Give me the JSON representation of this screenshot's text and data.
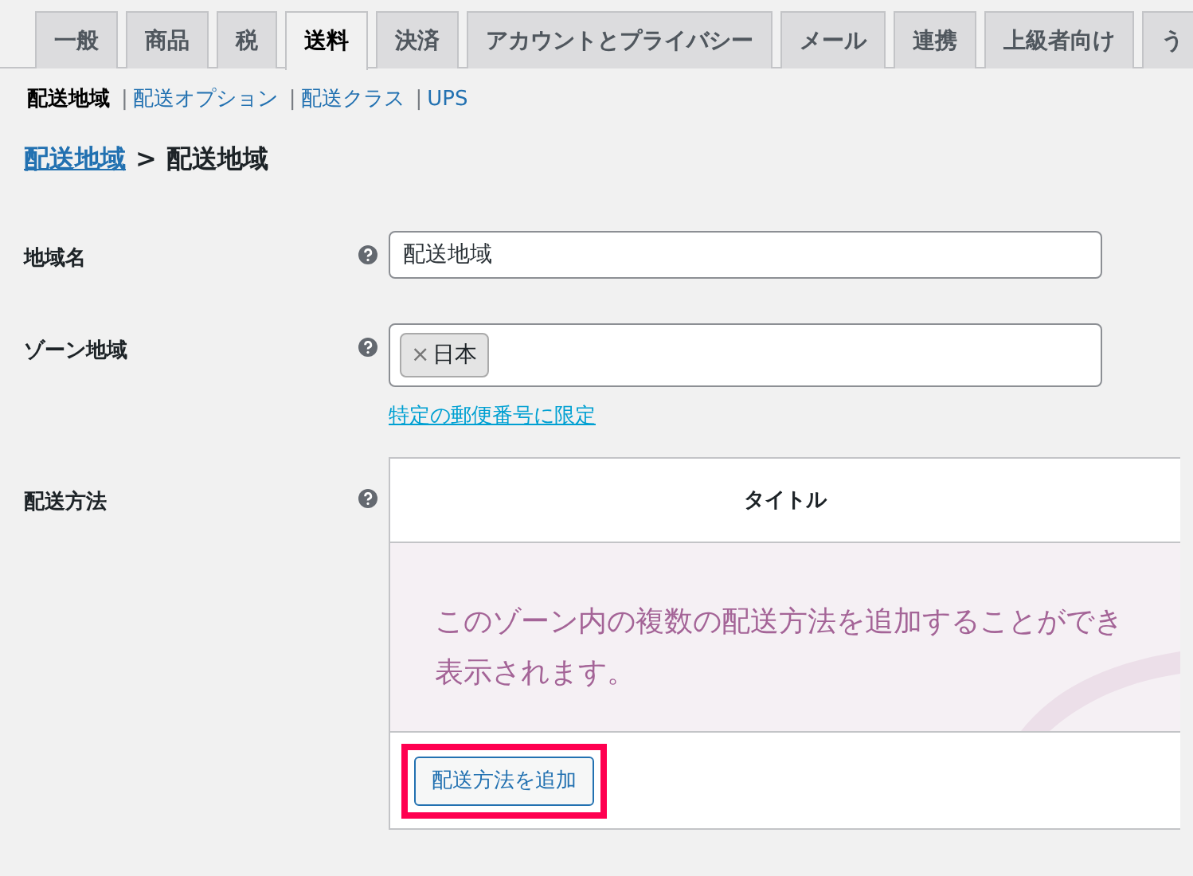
{
  "tabs": [
    {
      "label": "一般",
      "selected": false
    },
    {
      "label": "商品",
      "selected": false
    },
    {
      "label": "税",
      "selected": false
    },
    {
      "label": "送料",
      "selected": true
    },
    {
      "label": "決済",
      "selected": false
    },
    {
      "label": "アカウントとプライバシー",
      "selected": false
    },
    {
      "label": "メール",
      "selected": false
    },
    {
      "label": "連携",
      "selected": false
    },
    {
      "label": "上級者向け",
      "selected": false
    },
    {
      "label": "う",
      "selected": false
    }
  ],
  "subnav": [
    {
      "label": "配送地域",
      "selected": true
    },
    {
      "divider": "|",
      "label": "配送オプション",
      "selected": false
    },
    {
      "divider": "|",
      "label": "配送クラス",
      "selected": false
    },
    {
      "divider": "|",
      "label": "UPS",
      "selected": false
    }
  ],
  "breadcrumb": {
    "link": "配送地域",
    "separator": ">",
    "current": "配送地域"
  },
  "form": {
    "zone_name": {
      "label": "地域名",
      "value": "配送地域"
    },
    "zone_regions": {
      "label": "ゾーン地域",
      "tags": [
        {
          "remove": "×",
          "label": "日本"
        }
      ],
      "link": "特定の郵便番号に限定"
    },
    "shipping_methods": {
      "label": "配送方法",
      "column": "タイトル",
      "empty_lines": [
        "このゾーン内の複数の配送方法を追加することができ",
        "表示されます。"
      ],
      "button": {
        "label": "配送方法を追加",
        "highlighted": true
      }
    }
  }
}
